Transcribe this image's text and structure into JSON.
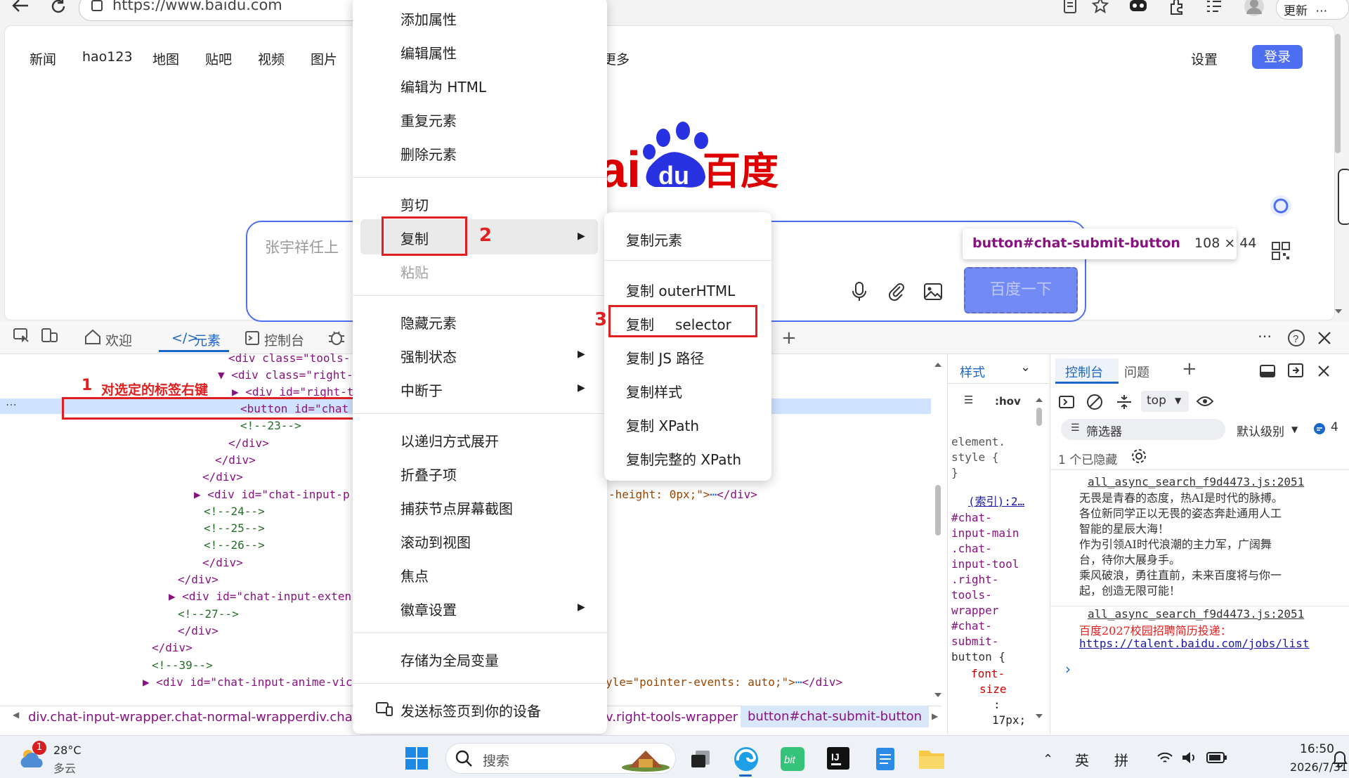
{
  "browser": {
    "url": "https://www.baidu.com",
    "update_label": "更新"
  },
  "baidu": {
    "nav": [
      "新闻",
      "hao123",
      "地图",
      "贴吧",
      "视频",
      "图片",
      "更多"
    ],
    "settings": "设置",
    "login": "登录",
    "logo_text": "百度",
    "logo_du": "du",
    "logo_ai": "ai",
    "search_placeholder": "张宇祥任上",
    "submit_label": "百度一下",
    "tooltip_selector": "button#chat-submit-button",
    "tooltip_size": "108 × 44"
  },
  "devtools": {
    "tabs": [
      "欢迎",
      "元素",
      "控制台"
    ],
    "dom_lines": [
      {
        "indent": "",
        "html": "<div class=\"tools-"
      },
      {
        "indent": "",
        "html": "<div class=\"right-"
      },
      {
        "indent": "",
        "html": "<div id=\"right-t"
      },
      {
        "indent": "",
        "html": "<button id=\"chat"
      },
      {
        "indent": "",
        "html": "<!--23-->"
      },
      {
        "indent": "",
        "html": "</div>"
      },
      {
        "indent": "",
        "html": "</div>"
      },
      {
        "indent": "",
        "html": "</div>"
      },
      {
        "indent": "",
        "html": "<div id=\"chat-input-p"
      },
      {
        "indent": "",
        "html": "<!--24-->"
      },
      {
        "indent": "",
        "html": "<!--25-->"
      },
      {
        "indent": "",
        "html": "<!--26-->"
      },
      {
        "indent": "",
        "html": "</div>"
      },
      {
        "indent": "",
        "html": "</div>"
      },
      {
        "indent": "",
        "html": "<div id=\"chat-input-exten"
      },
      {
        "indent": "",
        "html": "<!--27-->"
      },
      {
        "indent": "",
        "html": "</div>"
      },
      {
        "indent": "",
        "html": "</div>"
      },
      {
        "indent": "",
        "html": "<!--39-->"
      },
      {
        "indent": "",
        "html": "<div id=\"chat-input-anime-vic"
      }
    ],
    "dom_tail_1": "-height: 0px;\">",
    "dom_tail_2": "yle=\"pointer-events: auto;\">",
    "dom_close": "</div>",
    "dom_ellipsis": "⋯",
    "breadcrumbs": [
      "div.chat-input-wrapper.chat-normal-wrapper",
      "div.chat",
      "v.right-tools-wrapper",
      "button#chat-submit-button"
    ],
    "styles": {
      "tab": "样式",
      "hov": ":hov",
      "element_style": [
        "element.",
        "style {",
        "}"
      ],
      "link": "(索引):2…",
      "selector_lines": [
        "#chat-",
        "input-main",
        ".chat-",
        "input-tool",
        ".right-",
        "tools-",
        "wrapper",
        "#chat-",
        "submit-",
        "button {"
      ],
      "prop_lines": [
        "font-",
        "size",
        ":",
        "17px;"
      ]
    },
    "console": {
      "tabs": [
        "控制台",
        "问题"
      ],
      "context": "top",
      "filter": "筛选器",
      "level": "默认级别",
      "badge_count": "4",
      "hidden": "1 个已隐藏",
      "src1": "all_async_search_f9d4473.js:2051",
      "msg1": [
        "无畏是青春的态度，热AI是时代的脉搏。",
        "各位新同学正以无畏的姿态奔赴通用人工",
        "智能的星辰大海！",
        "作为引领AI时代浪潮的主力军，广阔舞",
        "台，待你大展身手。",
        "乘风破浪，勇往直前，未来百度将与你一",
        "起，创造无限可能！"
      ],
      "src2": "all_async_search_f9d4473.js:2051",
      "msg2": "百度2027校园招聘简历投递：",
      "link2": "https://talent.baidu.com/jobs/list",
      "prompt": "›"
    }
  },
  "context_menu": {
    "items": [
      "添加属性",
      "编辑属性",
      "编辑为 HTML",
      "重复元素",
      "删除元素",
      "剪切",
      "复制",
      "粘贴",
      "隐藏元素",
      "强制状态",
      "中断于",
      "以递归方式展开",
      "折叠子项",
      "捕获节点屏幕截图",
      "滚动到视图",
      "焦点",
      "徽章设置",
      "存储为全局变量",
      "发送标签页到你的设备"
    ],
    "submenu": [
      "复制元素",
      "复制 outerHTML",
      "复制",
      "selector",
      "复制 JS 路径",
      "复制样式",
      "复制 XPath",
      "复制完整的 XPath"
    ]
  },
  "annotations": {
    "step1_num": "1",
    "step1_text": "对选定的标签右键",
    "step2_num": "2",
    "step3_num": "3",
    "color": "#e02020"
  },
  "taskbar": {
    "weather_temp": "28°C",
    "weather_desc": "多云",
    "weather_badge": "1",
    "search": "搜索",
    "ime1": "英",
    "ime2": "拼",
    "time": "16:50",
    "date": "2026/7/31"
  }
}
